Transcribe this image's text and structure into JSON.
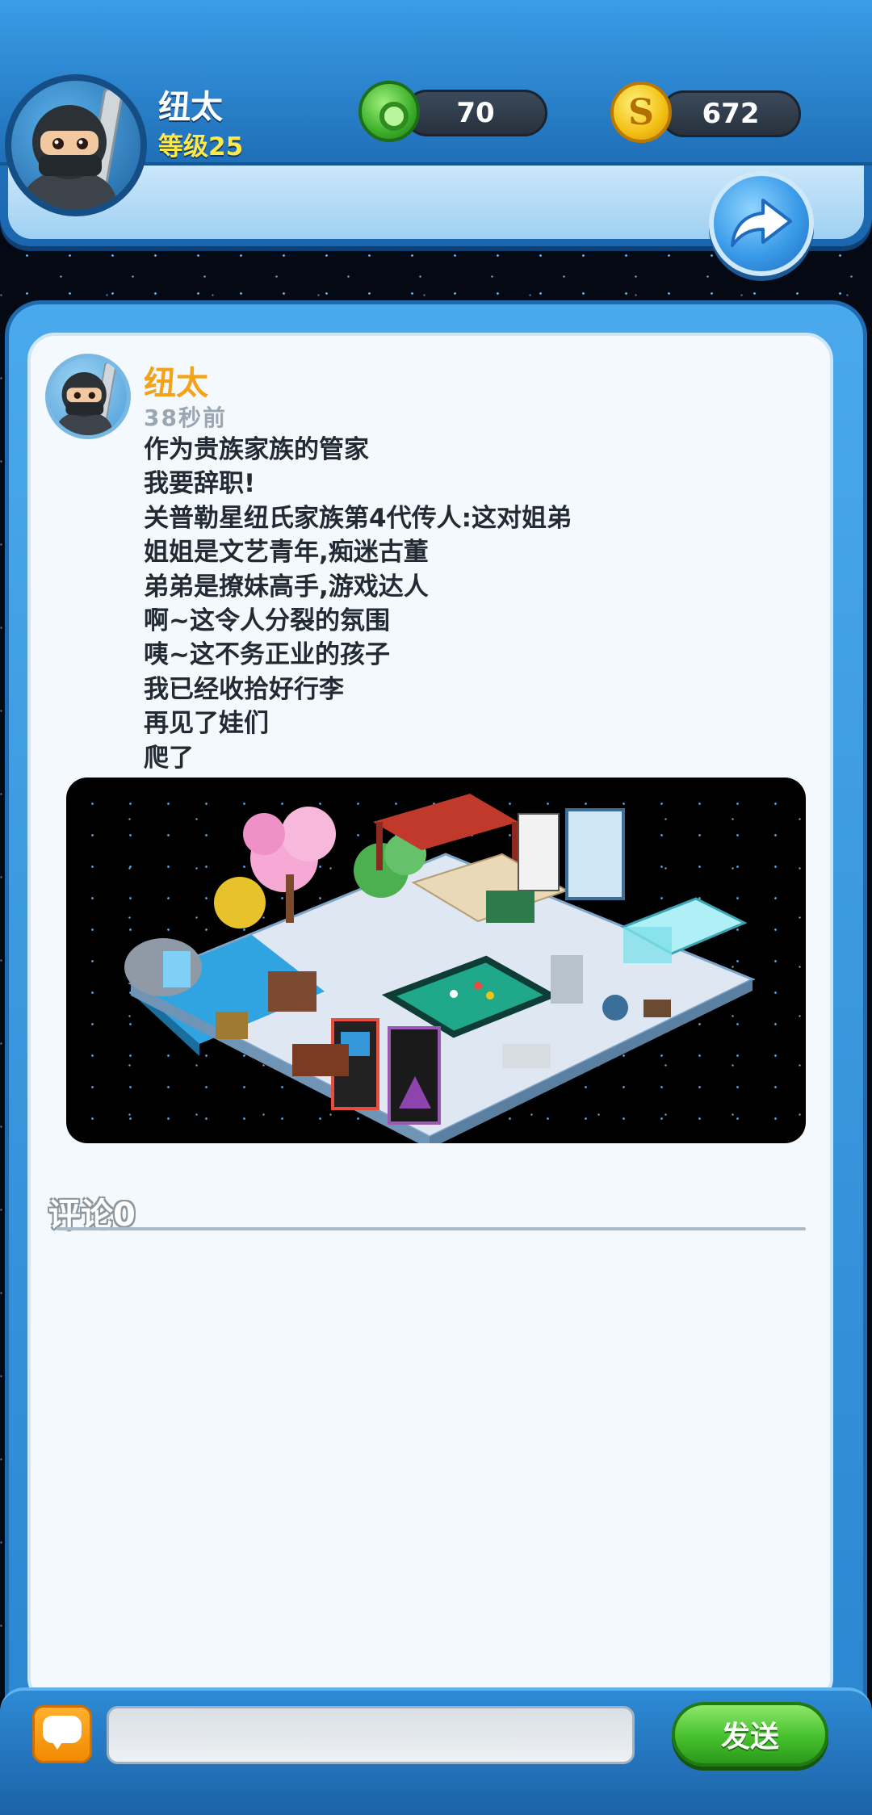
{
  "header": {
    "player_name": "纽太",
    "player_level": "等级25",
    "gems": "70",
    "coins": "672",
    "coin_symbol": "S"
  },
  "post": {
    "author": "纽太",
    "time": "38秒前",
    "lines": [
      "作为贵族家族的管家",
      "我要辞职!",
      "关普勒星纽氏家族第4代传人:这对姐弟",
      "姐姐是文艺青年,痴迷古董",
      "弟弟是撩妹高手,游戏达人",
      "啊~这令人分裂的氛围",
      "咦~这不务正业的孩子",
      "我已经收拾好行李",
      "再见了娃们",
      "爬了"
    ]
  },
  "comments": {
    "label": "评论0"
  },
  "composer": {
    "input_value": "",
    "input_placeholder": "",
    "send_label": "发送"
  },
  "colors": {
    "header_blue": "#2278c4",
    "level_yellow": "#ffe94a",
    "author_orange": "#f5a21b",
    "send_green": "#46c02e"
  }
}
